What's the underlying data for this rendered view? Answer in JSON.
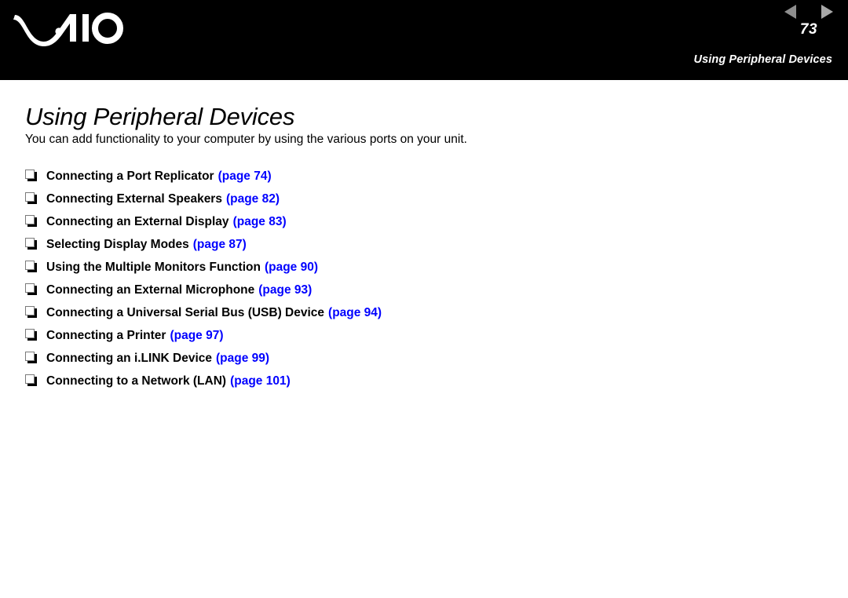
{
  "header": {
    "logo_text": "VAIO",
    "logo_name": "vaio-logo",
    "page_number": "73",
    "prev_arrow_icon": "triangle-left-icon",
    "next_arrow_icon": "triangle-right-icon",
    "running_title": "Using Peripheral Devices",
    "background_color": "#000000",
    "text_color": "#ffffff",
    "prev_arrow_color": "#8e8e8e",
    "next_arrow_color": "#a8a8a8"
  },
  "main": {
    "title": "Using Peripheral Devices",
    "intro": "You can add functionality to your computer by using the various ports on your unit.",
    "bullet_icon": "hollow-square-bullet-icon",
    "link_color": "#0000ff",
    "text_color": "#000000",
    "toc": [
      {
        "label": "Connecting a Port Replicator",
        "pageref": "(page 74)",
        "page": 74
      },
      {
        "label": "Connecting External Speakers",
        "pageref": "(page 82)",
        "page": 82
      },
      {
        "label": "Connecting an External Display",
        "pageref": "(page 83)",
        "page": 83
      },
      {
        "label": "Selecting Display Modes",
        "pageref": "(page 87)",
        "page": 87
      },
      {
        "label": "Using the Multiple Monitors Function",
        "pageref": "(page 90)",
        "page": 90
      },
      {
        "label": "Connecting an External Microphone",
        "pageref": "(page 93)",
        "page": 93
      },
      {
        "label": "Connecting a Universal Serial Bus (USB) Device",
        "pageref": "(page 94)",
        "page": 94
      },
      {
        "label": "Connecting a Printer",
        "pageref": "(page 97)",
        "page": 97
      },
      {
        "label": "Connecting an i.LINK Device",
        "pageref": "(page 99)",
        "page": 99
      },
      {
        "label": "Connecting to a Network (LAN)",
        "pageref": "(page 101)",
        "page": 101
      }
    ]
  }
}
